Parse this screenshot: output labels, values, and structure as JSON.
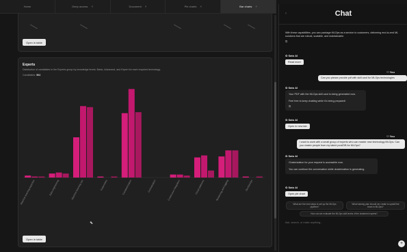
{
  "tabs": [
    {
      "label": "Home",
      "closable": false
    },
    {
      "label": "Deep access",
      "closable": true
    },
    {
      "label": "Document",
      "closable": true
    },
    {
      "label": "Pie charts",
      "closable": true
    },
    {
      "label": "Bar charts",
      "closable": true,
      "active": true
    }
  ],
  "top_card": {
    "open_button": "Open in table"
  },
  "experts_card": {
    "title": "Experts",
    "subtitle": "Distribution of candidates in the Experts group by knowledge levels: Basic, Advanced, and Expert for each required technology.",
    "candidates_label": "Candidates:",
    "candidates_value": "564",
    "open_button": "Open in table"
  },
  "chart_data": {
    "type": "bar",
    "categories": [
      "Machine learning expertise",
      "Data engineering",
      "Machine learning ops",
      "Kubernetes",
      "Containerization",
      "Orchestration",
      "Continuous integration",
      "Cloud platforms",
      "Monitoring and logging",
      "DevSecOps"
    ],
    "series": [
      {
        "values": [
          2,
          4,
          40,
          1,
          64,
          0,
          3,
          20,
          21,
          1
        ],
        "color": "#d41e7a"
      },
      {
        "values": [
          1,
          5,
          71,
          0,
          88,
          0,
          3,
          22,
          27,
          0
        ],
        "color": "#c2186e"
      },
      {
        "values": [
          1,
          4,
          70,
          1,
          65,
          0,
          2,
          7,
          27,
          1
        ],
        "color": "#a8185e"
      }
    ],
    "ylim": [
      0,
      95
    ]
  },
  "chat": {
    "title": "Chat",
    "intro": "With these capabilities, you can package MLOps as a service to customers, delivering end-to-end ML solutions that are robust, scalable, and maintainable.",
    "ai_name": "Sato AI",
    "user_name": "You",
    "read_more": "Read more",
    "user_msg_1": "Can you please provide pdf with skill card for MLOps technologies",
    "ai_msg_1a": "Your PDF with the MLOps skill card is being generated now.",
    "ai_msg_1b": "Feel free to keep chatting while it's being prepared!",
    "open_new_tab": "Open in new tab",
    "user_msg_2": "I want to work with a small group of experts who can master new technology MLOps. Can you cluster people from my talent pool/DB for MLOps?",
    "ai_msg_2a": "Clusterization for your request is accessible now.",
    "ai_msg_2b": "You can continue the conversation while clusterization is generating.",
    "open_pie_chart": "Open pie chart",
    "suggestions": [
      "What are the next steps to set up the MLOps pipeline?",
      "What training plan should we create to upskill the team in MLOps?",
      "How can we evaluate the MLOps skill levels of the clustered experts?"
    ],
    "input_placeholder": "Ask, search, or make anything...",
    "send_glyph": "+",
    "back_glyph": "‹",
    "copy_glyph": "⧉",
    "person_glyph": "⚇",
    "ai_glyph": "✿"
  }
}
